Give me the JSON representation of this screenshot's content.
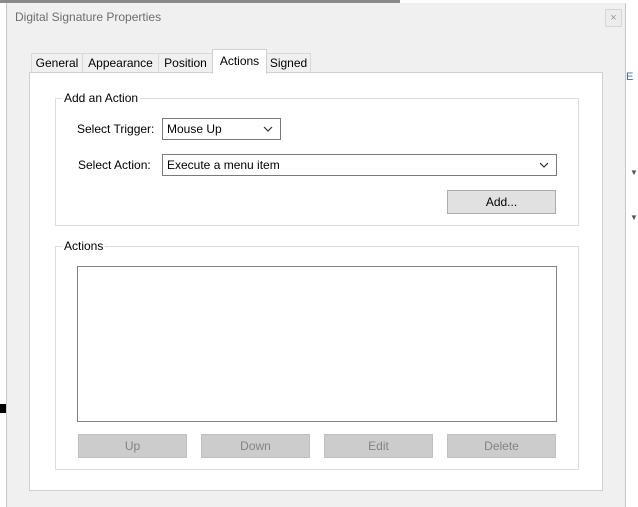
{
  "window": {
    "title": "Digital Signature Properties",
    "close_glyph": "×"
  },
  "tabs": [
    {
      "label": "General",
      "active": false
    },
    {
      "label": "Appearance",
      "active": false
    },
    {
      "label": "Position",
      "active": false
    },
    {
      "label": "Actions",
      "active": true
    },
    {
      "label": "Signed",
      "active": false
    }
  ],
  "add_action": {
    "legend": "Add an Action",
    "trigger_label": "Select Trigger:",
    "trigger_value": "Mouse Up",
    "action_label": "Select Action:",
    "action_value": "Execute a menu item",
    "add_button": "Add..."
  },
  "actions": {
    "legend": "Actions",
    "items": [],
    "buttons": {
      "up": "Up",
      "down": "Down",
      "edit": "Edit",
      "delete": "Delete"
    }
  },
  "background": {
    "edge_letter": "E"
  },
  "colors": {
    "dialog_bg": "#f0f0f0",
    "panel_bg": "#ffffff",
    "disabled_button": "#cccccc"
  },
  "icons": {
    "close": "close-icon",
    "dropdown": "chevron-down-icon"
  }
}
